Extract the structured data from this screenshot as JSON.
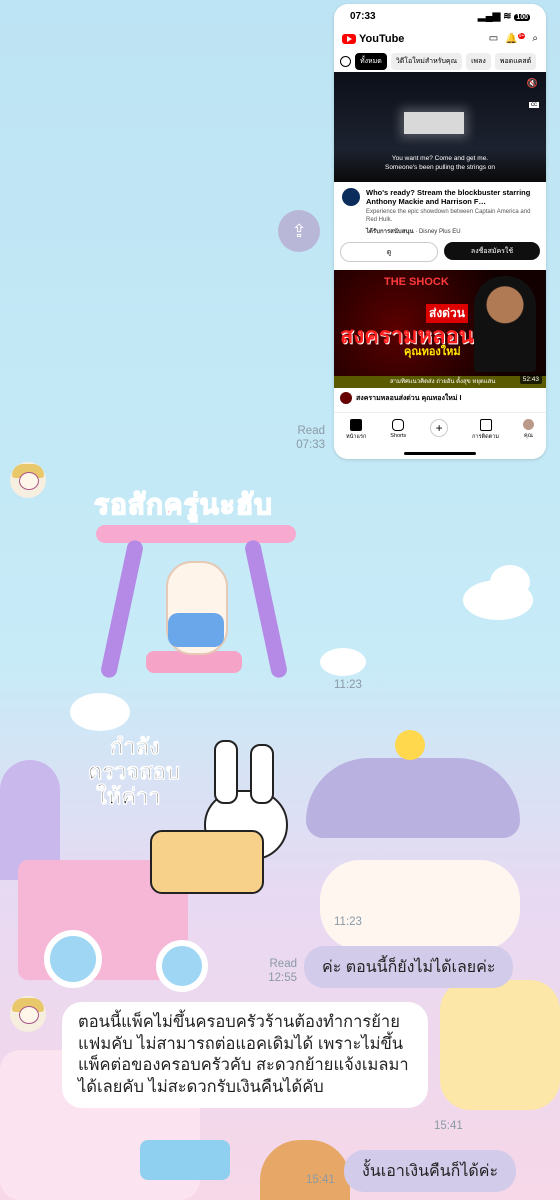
{
  "youtube": {
    "status_time": "07:33",
    "battery": "100",
    "notifications": "9+",
    "logo_text": "YouTube",
    "chips": [
      "ทั้งหมด",
      "วิดีโอใหม่สำหรับคุณ",
      "เพลง",
      "พอดแคสต์"
    ],
    "video1_subtitle_1": "You want me? Come and get me.",
    "video1_subtitle_2": "Someone's been pulling the strings on",
    "ad_title": "Who's ready? Stream the blockbuster starring Anthony Mackie and Harrison F…",
    "ad_desc": "Experience the epic showdown between Captain America and Red Hulk.",
    "ad_sponsored": "ได้รับการสนับสนุน",
    "ad_channel": "Disney Plus EU",
    "ad_watch_label": "ดู",
    "ad_subscribe_label": "ลงชื่อสมัครใช้",
    "video2_top": "THE SHOCK",
    "video2_urgent": "ส่งด่วน",
    "video2_main": "สงครามหลอน",
    "video2_name": "คุณทองใหม่",
    "video2_strip": "สามทิศแนวคิดส่ง ถ่ายอัน ตั้งสุข หยุดแสน",
    "video2_duration": "52:43",
    "video2_title": "สงครามหลอนส่งด่วน คุณทองใหม่ I",
    "nav": [
      "หน้าแรก",
      "Shorts",
      "",
      "การติดตาม",
      "คุณ"
    ]
  },
  "chat": {
    "read_label": "Read",
    "time_first": "07:33",
    "time_sticker1": "11:23",
    "time_sticker2": "11:23",
    "time_reply1": "12:55",
    "time_long_msg": "15:41",
    "time_reply2": "15:41",
    "sticker1_text": "รอสักครู่นะฮับ",
    "sticker2_text_1": "กำลัง",
    "sticker2_text_2": "ตรวจสอบ",
    "sticker2_text_3": "ให้ค่าา",
    "reply1": "ค่ะ ตอนนี้ก็ยังไม่ได้เลยค่ะ",
    "long_msg": "ตอนนี้แพ็คไม่ขึ้นครอบครัวร้านต้องทำการย้ายแฟมคับ ไม่สามารถต่อแอคเดิมได้ เพราะไม่ขึ้นแพ็คต่อของครอบครัวคับ สะดวกย้ายแจ้งเมลมาได้เลยคับ ไม่สะดวกรับเงินคืนได้คับ",
    "reply2": "งั้นเอาเงินคืนก็ได้ค่ะ"
  }
}
